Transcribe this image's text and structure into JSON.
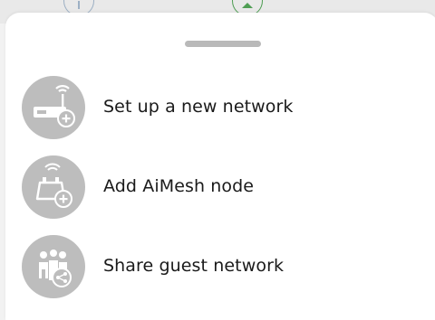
{
  "sheet": {
    "items": [
      {
        "label": "Set up a new network",
        "icon": "router-add-icon"
      },
      {
        "label": "Add AiMesh node",
        "icon": "mesh-node-add-icon"
      },
      {
        "label": "Share guest network",
        "icon": "guest-share-icon"
      }
    ]
  },
  "colors": {
    "icon_bg": "#bdbdbd",
    "icon_fg": "#ffffff",
    "text": "#1a1a1a",
    "handle": "#b9b9b9",
    "background_icon_left": "#9db0c4",
    "background_icon_right": "#4f9e54"
  }
}
